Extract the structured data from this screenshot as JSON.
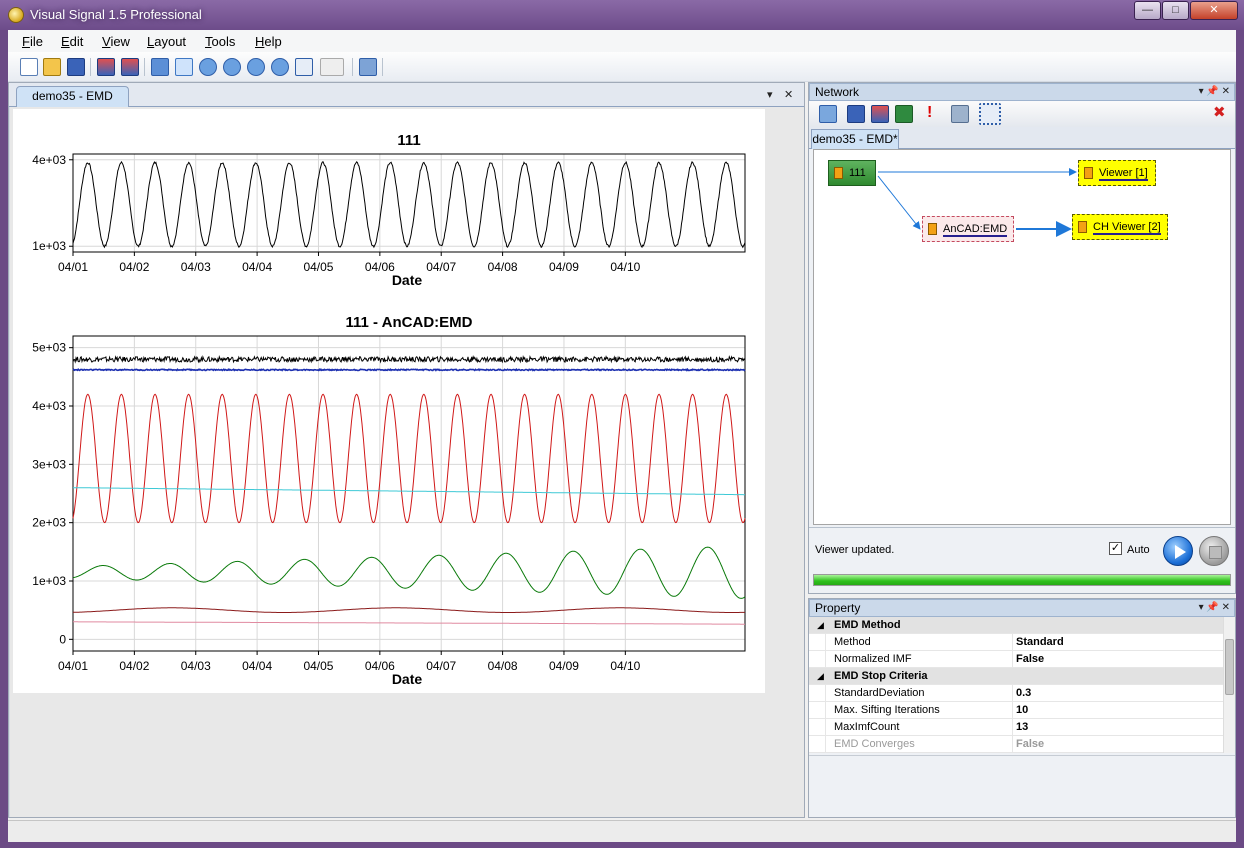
{
  "window": {
    "title": "Visual Signal 1.5 Professional",
    "min": "0",
    "max": "1",
    "close": "r"
  },
  "menu": [
    {
      "key": "F",
      "rest": "ile"
    },
    {
      "key": "E",
      "rest": "dit"
    },
    {
      "key": "V",
      "rest": "iew"
    },
    {
      "key": "L",
      "rest": "ayout"
    },
    {
      "key": "T",
      "rest": "ools"
    },
    {
      "key": "H",
      "rest": "elp"
    }
  ],
  "toolbar_icons": [
    "new-file-icon",
    "open-folder-icon",
    "save-icon",
    "view-chart-icon",
    "view-chart-export-icon",
    "home-icon",
    "zoom-select-icon",
    "zoom-in-icon",
    "zoom-out-icon",
    "zoom-fit-icon",
    "zoom-y-icon",
    "axis-value-icon",
    "axis-value-dropdown-icon",
    "tools-wrench-icon"
  ],
  "document": {
    "tab_label": "demo35 - EMD",
    "dropdown": "▾",
    "close": "✕"
  },
  "chart_data": [
    {
      "type": "line",
      "title": "111",
      "xlabel": "Date",
      "ylabel": "",
      "x_ticks": [
        "04/01",
        "04/02",
        "04/03",
        "04/04",
        "04/05",
        "04/06",
        "04/07",
        "04/08",
        "04/09",
        "04/10"
      ],
      "y_ticks": [
        "4e+03",
        "1e+03"
      ],
      "ylim": [
        800,
        4200
      ],
      "series": [
        {
          "color": "#000000",
          "x_range": [
            "04/01",
            "04/11"
          ],
          "cycles": 20,
          "peak_y": 3900,
          "trough_y": 1000
        }
      ]
    },
    {
      "type": "line",
      "title": "111 - AnCAD:EMD",
      "xlabel": "Date",
      "ylabel": "",
      "x_ticks": [
        "04/01",
        "04/02",
        "04/03",
        "04/04",
        "04/05",
        "04/06",
        "04/07",
        "04/08",
        "04/09",
        "04/10"
      ],
      "y_ticks": [
        "5e+03",
        "4e+03",
        "3e+03",
        "2e+03",
        "1e+03",
        "0"
      ],
      "ylim": [
        -200,
        5200
      ],
      "series": [
        {
          "color": "#000000",
          "level": 4800,
          "kind": "noise"
        },
        {
          "color": "#1c2fb0",
          "level": 4620,
          "kind": "flat"
        },
        {
          "color": "#d01818",
          "center": 3100,
          "amplitude": 1100,
          "cycles": 20,
          "kind": "oscillation"
        },
        {
          "color": "#3ec9d6",
          "start": 2600,
          "end": 2480,
          "kind": "trend"
        },
        {
          "color": "#0a7a0a",
          "center": 1150,
          "amplitude_start": 100,
          "amplitude_end": 450,
          "cycles": 10,
          "kind": "oscillation"
        },
        {
          "color": "#8b1a1a",
          "center": 500,
          "amplitude": 40,
          "cycles": 3,
          "kind": "oscillation"
        },
        {
          "color": "#e08aa0",
          "start": 300,
          "end": 260,
          "kind": "trend"
        }
      ]
    }
  ],
  "network": {
    "title": "Network",
    "ctrls": "▾ 📌 ✕",
    "toolbar_icons": [
      "add-node-icon",
      "copy-node-icon",
      "chart-node-icon",
      "excel-icon",
      "alert-icon",
      "export-icon",
      "select-area-icon"
    ],
    "delete_icon": "✖",
    "tab_label": "demo35 - EMD*",
    "nodes": {
      "source": "111",
      "viewer1": "Viewer [1]",
      "emd": "AnCAD:EMD",
      "viewer2": "CH Viewer [2]"
    },
    "status": "Viewer updated.",
    "auto_label": "Auto",
    "auto_checked": "✓",
    "progress_percent": 100
  },
  "property": {
    "title": "Property",
    "ctrls": "▾ 📌 ✕",
    "rows": [
      {
        "type": "cat",
        "label": "EMD Method"
      },
      {
        "type": "prop",
        "name": "Method",
        "value": "Standard"
      },
      {
        "type": "prop",
        "name": "Normalized IMF",
        "value": "False"
      },
      {
        "type": "cat",
        "label": "EMD Stop Criteria"
      },
      {
        "type": "prop",
        "name": "StandardDeviation",
        "value": "0.3"
      },
      {
        "type": "prop",
        "name": "Max. Sifting Iterations",
        "value": "10"
      },
      {
        "type": "prop",
        "name": "MaxImfCount",
        "value": "13"
      },
      {
        "type": "prop-dim",
        "name": "EMD Converges",
        "value": "False"
      }
    ]
  }
}
